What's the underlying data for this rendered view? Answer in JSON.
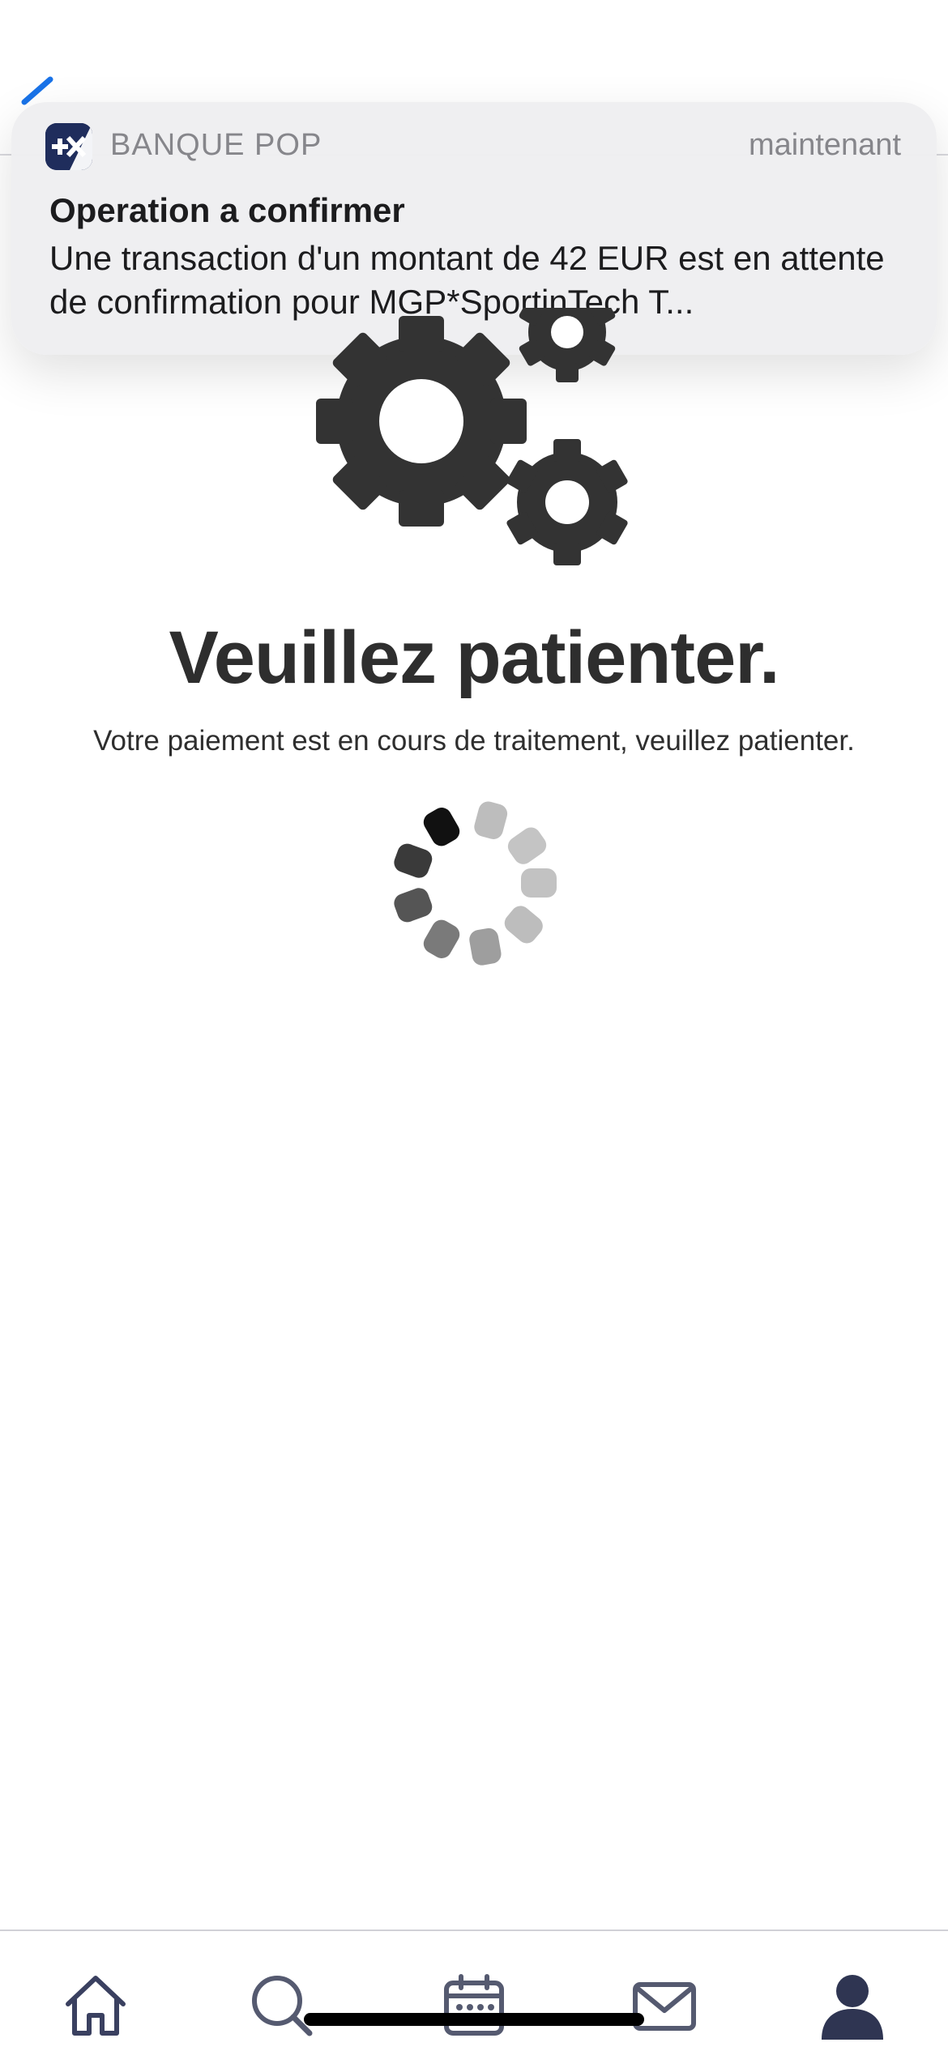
{
  "notification": {
    "app_name": "BANQUE POP",
    "time": "maintenant",
    "title": "Operation a confirmer",
    "body": "Une transaction d'un montant de 42 EUR est en attente de confirmation pour MGP*SportinTech T..."
  },
  "main": {
    "heading": "Veuillez patienter.",
    "message": "Votre paiement est en cours de traitement, veuillez patienter."
  },
  "tabbar": {
    "items": [
      {
        "icon": "home-icon"
      },
      {
        "icon": "search-icon"
      },
      {
        "icon": "calendar-icon"
      },
      {
        "icon": "mail-icon"
      },
      {
        "icon": "profile-icon"
      }
    ]
  },
  "colors": {
    "accent_blue": "#1a73e8",
    "gear": "#333333",
    "brand_navy": "#1f2d5c",
    "tab_icon": "#3a4060"
  }
}
